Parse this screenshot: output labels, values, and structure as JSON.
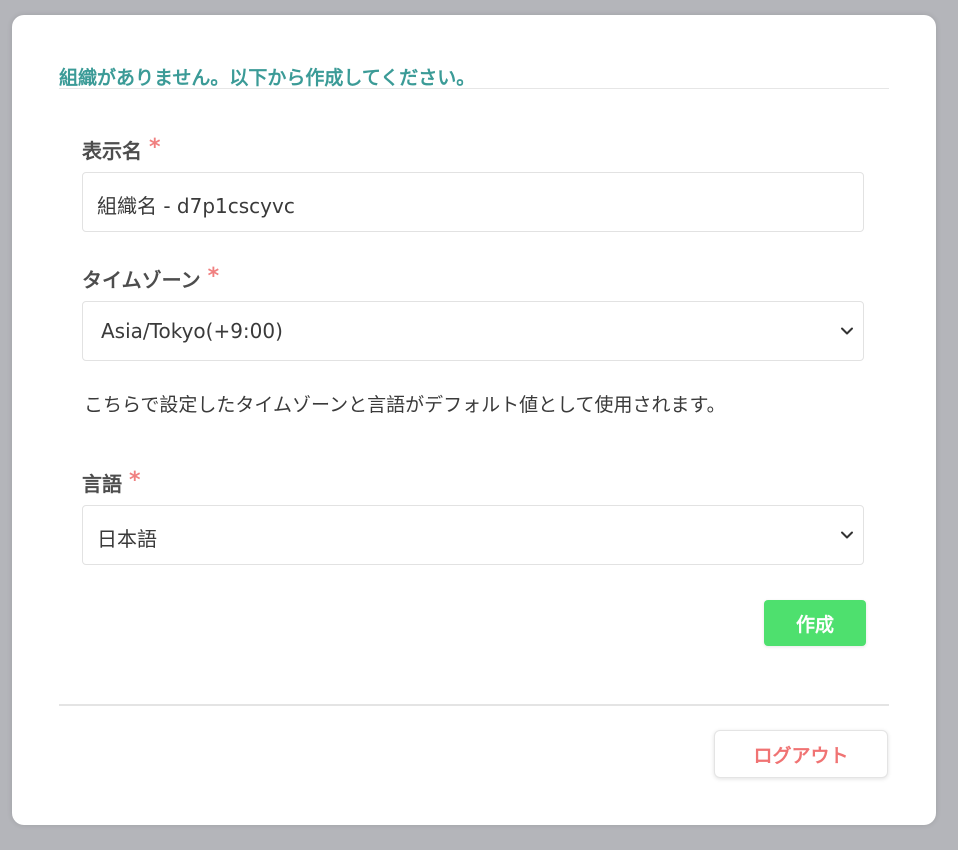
{
  "form": {
    "heading": "組織がありません。以下から作成してください。",
    "display_name": {
      "label": "表示名",
      "required_mark": "*",
      "value": "組織名 - d7p1cscyvc"
    },
    "timezone": {
      "label": "タイムゾーン",
      "required_mark": "*",
      "selected": "Asia/Tokyo(+9:00)"
    },
    "help_text": "こちらで設定したタイムゾーンと言語がデフォルト値として使用されます。",
    "language": {
      "label": "言語",
      "required_mark": "*",
      "selected": "日本語"
    },
    "create_label": "作成"
  },
  "footer": {
    "logout_label": "ログアウト"
  },
  "icons": {
    "select_arrow": "chevron-down-icon"
  },
  "colors": {
    "heading": "#3b9b97",
    "required": "#f08080",
    "create_button": "#4ee06e",
    "logout_text": "#f07373",
    "backdrop": "#b4b5ba"
  }
}
